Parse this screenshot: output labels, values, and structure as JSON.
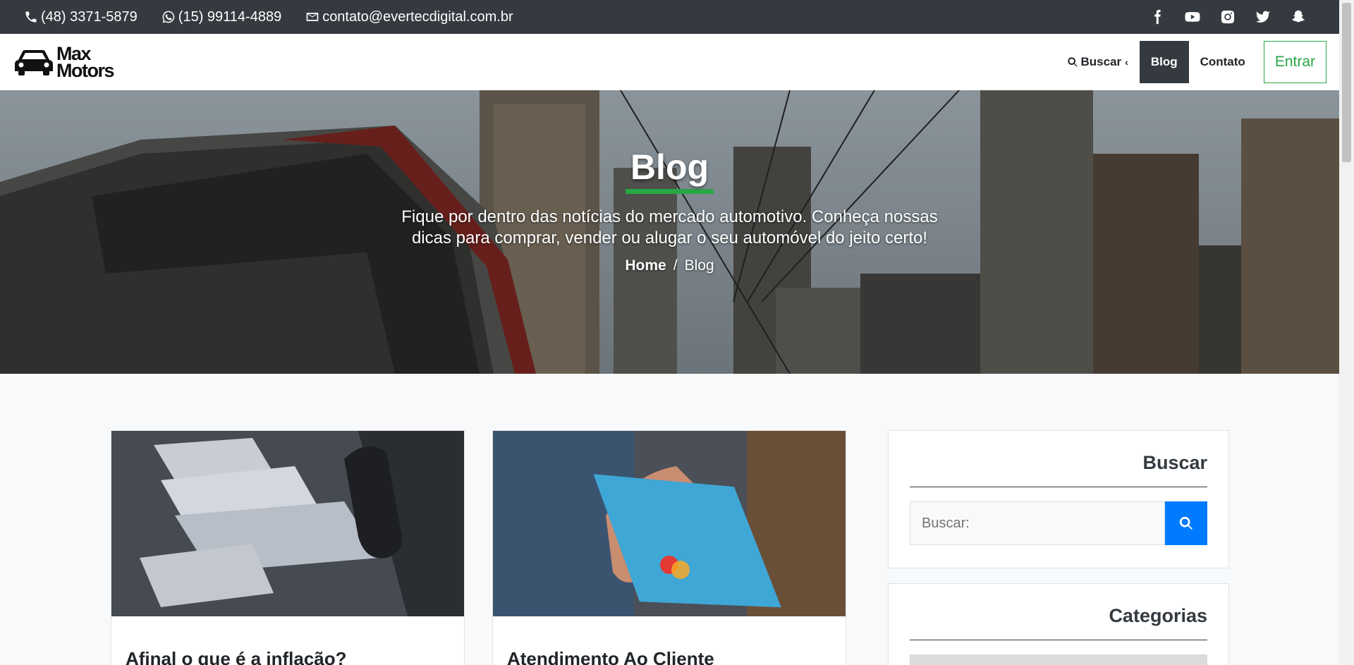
{
  "topbar": {
    "phone": "(48) 3371-5879",
    "whatsapp": "(15) 99114-4889",
    "email": "contato@evertecdigital.com.br",
    "socials": [
      "facebook-icon",
      "youtube-icon",
      "instagram-icon",
      "twitter-icon",
      "snapchat-icon"
    ]
  },
  "nav": {
    "logo_line1": "Max",
    "logo_line2": "Motors",
    "search_label": "Buscar",
    "blog_label": "Blog",
    "contact_label": "Contato",
    "login_label": "Entrar"
  },
  "hero": {
    "title": "Blog",
    "subtitle": "Fique por dentro das notícias do mercado automotivo. Conheça nossas dicas para comprar, vender ou alugar o seu automóvel do jeito certo!",
    "breadcrumb_home": "Home",
    "breadcrumb_sep": "/",
    "breadcrumb_current": "Blog"
  },
  "posts": [
    {
      "title": "Afinal o que é a inflação?"
    },
    {
      "title": "Atendimento Ao Cliente"
    }
  ],
  "sidebar": {
    "search_title": "Buscar",
    "search_placeholder": "Buscar:",
    "categories_title": "Categorias"
  },
  "colors": {
    "dark": "#343a40",
    "accent_green": "#28a745",
    "accent_blue": "#007bff"
  }
}
